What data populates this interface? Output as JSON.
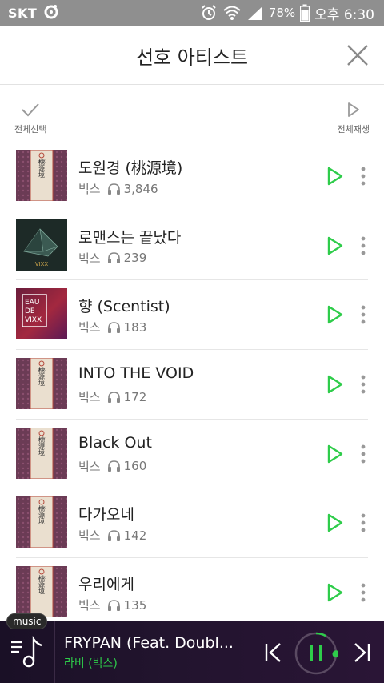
{
  "status_bar": {
    "carrier": "SKT",
    "battery": "78%",
    "time": "오후 6:30"
  },
  "header": {
    "title": "선호 아티스트"
  },
  "actions": {
    "select_all": "전체선택",
    "play_all": "전체재생"
  },
  "songs": [
    {
      "title": "도원경 (桃源境)",
      "artist": "빅스",
      "plays": "3,846",
      "cover": "shangrila"
    },
    {
      "title": "로맨스는 끝났다",
      "artist": "빅스",
      "plays": "239",
      "cover": "dark-crystal"
    },
    {
      "title": "향 (Scentist)",
      "artist": "빅스",
      "plays": "183",
      "cover": "eau-de-vixx"
    },
    {
      "title": "INTO THE VOID",
      "artist": "빅스",
      "plays": "172",
      "cover": "shangrila"
    },
    {
      "title": "Black Out",
      "artist": "빅스",
      "plays": "160",
      "cover": "shangrila"
    },
    {
      "title": "다가오네",
      "artist": "빅스",
      "plays": "142",
      "cover": "shangrila"
    },
    {
      "title": "우리에게",
      "artist": "빅스",
      "plays": "135",
      "cover": "shangrila"
    }
  ],
  "cover_text": {
    "shangrila_hanja": "桃源境",
    "shangrila_brand": "VIXX",
    "eau_line1": "EAU",
    "eau_line2": "DE",
    "eau_line3": "VIXX",
    "crystal_brand": "VIXX"
  },
  "player": {
    "badge": "music",
    "title": "FRYPAN (Feat. Doubl...",
    "artist": "라비 (빅스)",
    "progress": 0.08
  },
  "colors": {
    "accent_green": "#2ecc4a",
    "status_bar": "#8f8f8f",
    "player_bg": "#1e1229"
  }
}
